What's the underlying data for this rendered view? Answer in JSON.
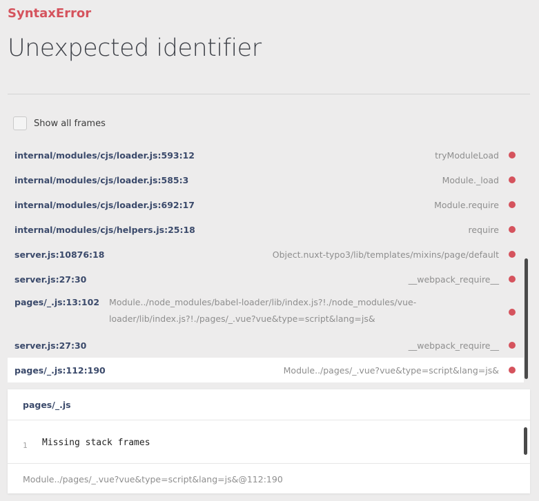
{
  "error": {
    "name": "SyntaxError",
    "message": "Unexpected identifier"
  },
  "show_all_frames": {
    "label": "Show all frames",
    "checked": false
  },
  "frames": [
    {
      "file": "internal/modules/cjs/loader.js:593:12",
      "fn": "tryModuleLoad"
    },
    {
      "file": "internal/modules/cjs/loader.js:585:3",
      "fn": "Module._load"
    },
    {
      "file": "internal/modules/cjs/loader.js:692:17",
      "fn": "Module.require"
    },
    {
      "file": "internal/modules/cjs/helpers.js:25:18",
      "fn": "require"
    },
    {
      "file": "server.js:10876:18",
      "fn": "Object.nuxt-typo3/lib/templates/mixins/page/default"
    },
    {
      "file": "server.js:27:30",
      "fn": "__webpack_require__"
    },
    {
      "file": "pages/_.js:13:102",
      "fn": "Module../node_modules/babel-loader/lib/index.js?!./node_modules/vue-loader/lib/index.js?!./pages/_.vue?vue&type=script&lang=js&"
    },
    {
      "file": "server.js:27:30",
      "fn": "__webpack_require__"
    },
    {
      "file": "pages/_.js:112:190",
      "fn": "Module../pages/_.vue?vue&type=script&lang=js&"
    }
  ],
  "code_panel": {
    "file": "pages/_.js",
    "line_number": "1",
    "code": "Missing stack frames",
    "footer": "Module../pages/_.vue?vue&type=script&lang=js&@112:190"
  },
  "colors": {
    "error": "#d5535d",
    "background": "#edecec",
    "file_link": "#3b4a6b"
  }
}
